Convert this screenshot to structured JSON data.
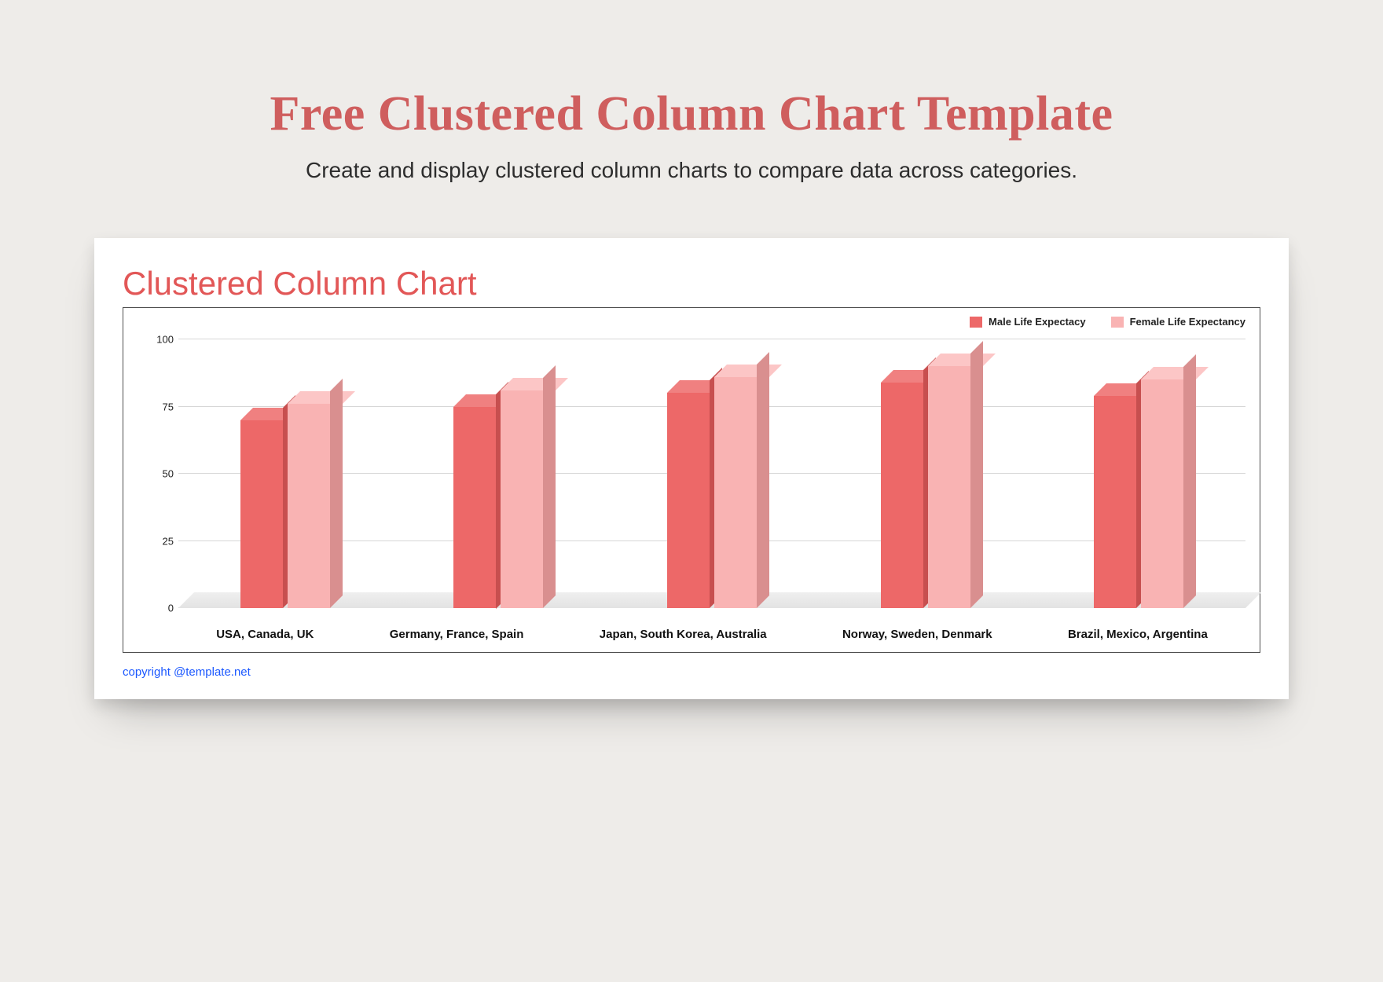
{
  "page": {
    "title": "Free Clustered Column Chart Template",
    "subtitle": "Create and display clustered column charts to compare data across categories."
  },
  "card": {
    "chart_title": "Clustered Column Chart",
    "copyright": "copyright @template.net"
  },
  "legend": {
    "male": "Male Life Expectacy",
    "female": "Female Life Expectancy"
  },
  "colors": {
    "male": "#ed6868",
    "female": "#f9b3b3",
    "title": "#cf5e5e"
  },
  "chart_data": {
    "type": "bar",
    "title": "Clustered Column Chart",
    "xlabel": "",
    "ylabel": "",
    "ylim": [
      0,
      100
    ],
    "y_ticks": [
      0,
      25,
      50,
      75,
      100
    ],
    "categories": [
      "USA, Canada, UK",
      "Germany, France, Spain",
      "Japan, South Korea, Australia",
      "Norway, Sweden, Denmark",
      "Brazil, Mexico, Argentina"
    ],
    "series": [
      {
        "name": "Male Life Expectacy",
        "values": [
          70,
          75,
          80,
          84,
          79
        ]
      },
      {
        "name": "Female Life Expectancy",
        "values": [
          76,
          81,
          86,
          90,
          85
        ]
      }
    ]
  }
}
